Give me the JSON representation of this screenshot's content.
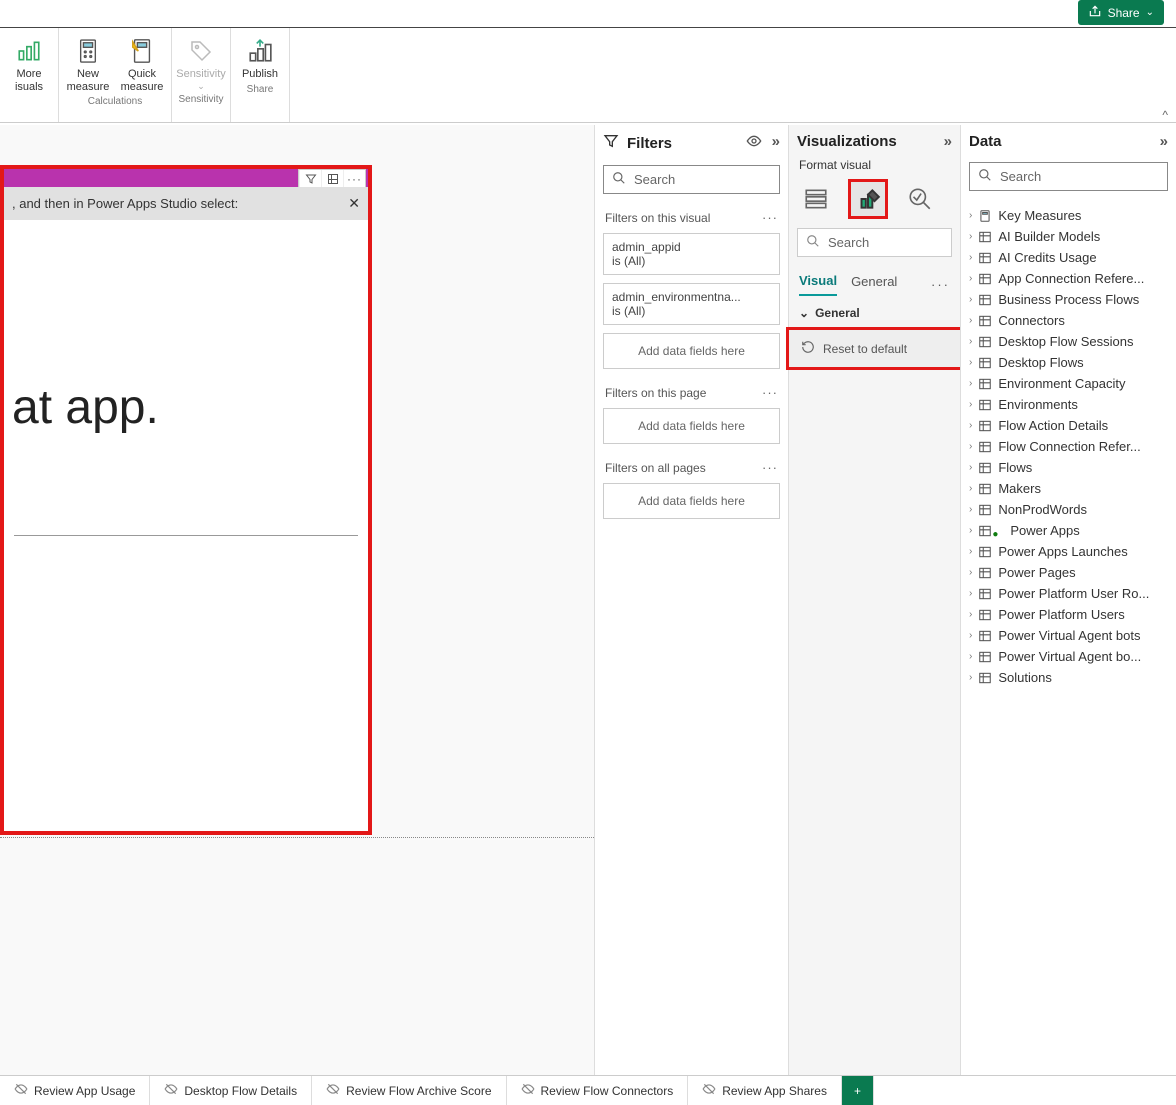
{
  "titlebar": {
    "share_label": "Share"
  },
  "ribbon": {
    "items": [
      {
        "label_line1": "More",
        "label_line2": "isuals"
      },
      {
        "label_line1": "New",
        "label_line2": "measure"
      },
      {
        "label_line1": "Quick",
        "label_line2": "measure"
      },
      {
        "label_line1": "Sensitivity",
        "label_line2": ""
      },
      {
        "label_line1": "Publish",
        "label_line2": ""
      }
    ],
    "groups": [
      "",
      "Calculations",
      "Sensitivity",
      "Share"
    ]
  },
  "canvas": {
    "message_fragment": ", and then in Power Apps Studio select:",
    "body_text": "at app."
  },
  "filters": {
    "header": "Filters",
    "search_placeholder": "Search",
    "section_visual": "Filters on this visual",
    "f1_name": "admin_appid",
    "f1_state": "is (All)",
    "f2_name": "admin_environmentna...",
    "f2_state": "is (All)",
    "add1": "Add data fields here",
    "section_page": "Filters on this page",
    "add2": "Add data fields here",
    "section_all": "Filters on all pages",
    "add3": "Add data fields here"
  },
  "viz": {
    "header": "Visualizations",
    "subtitle": "Format visual",
    "search_placeholder": "Search",
    "tab_visual": "Visual",
    "tab_general": "General",
    "section_general": "General",
    "reset_label": "Reset to default"
  },
  "data": {
    "header": "Data",
    "search_placeholder": "Search",
    "tables": [
      "Key Measures",
      "AI Builder Models",
      "AI Credits Usage",
      "App Connection Refere...",
      "Business Process Flows",
      "Connectors",
      "Desktop Flow Sessions",
      "Desktop Flows",
      "Environment Capacity",
      "Environments",
      "Flow Action Details",
      "Flow Connection Refer...",
      "Flows",
      "Makers",
      "NonProdWords",
      "Power Apps",
      "Power Apps Launches",
      "Power Pages",
      "Power Platform User Ro...",
      "Power Platform Users",
      "Power Virtual Agent bots",
      "Power Virtual Agent bo...",
      "Solutions"
    ]
  },
  "pages": {
    "tabs": [
      "Review App Usage",
      "Desktop Flow Details",
      "Review Flow Archive Score",
      "Review Flow Connectors",
      "Review App Shares"
    ]
  }
}
